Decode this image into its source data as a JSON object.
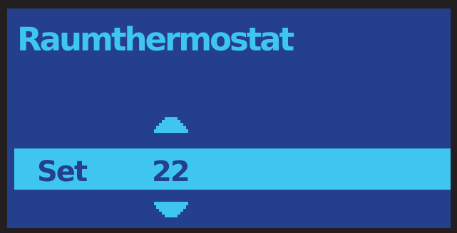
{
  "display": {
    "title": "Raumthermostat",
    "set_label": "Set",
    "set_value": "22"
  },
  "icons": {
    "up": "arrow-up-icon",
    "down": "arrow-down-icon"
  },
  "colors": {
    "background": "#243f8c",
    "accent": "#3ec6f0",
    "bezel": "#231f20"
  }
}
